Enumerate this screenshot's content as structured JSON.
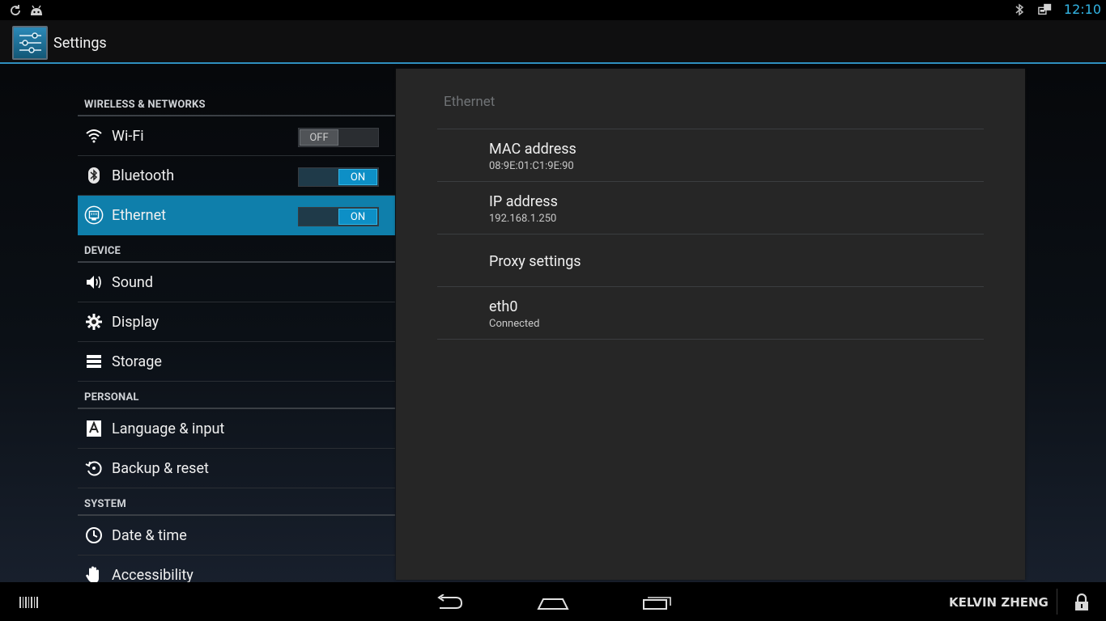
{
  "statusbar": {
    "time": "12:10",
    "left_icons": [
      "sync-icon",
      "android-debug-icon"
    ],
    "right_icons": [
      "bluetooth-icon",
      "ethernet-status-icon"
    ]
  },
  "actionbar": {
    "title": "Settings",
    "icon": "settings-app-icon"
  },
  "sidebar": {
    "sections": [
      {
        "header": "WIRELESS & NETWORKS",
        "items": [
          {
            "label": "Wi-Fi",
            "icon": "wifi-icon",
            "toggle": "OFF"
          },
          {
            "label": "Bluetooth",
            "icon": "bluetooth-icon",
            "toggle": "ON"
          },
          {
            "label": "Ethernet",
            "icon": "ethernet-icon",
            "toggle": "ON",
            "selected": true
          }
        ]
      },
      {
        "header": "DEVICE",
        "items": [
          {
            "label": "Sound",
            "icon": "speaker-icon"
          },
          {
            "label": "Display",
            "icon": "display-icon"
          },
          {
            "label": "Storage",
            "icon": "storage-icon"
          }
        ]
      },
      {
        "header": "PERSONAL",
        "items": [
          {
            "label": "Language & input",
            "icon": "language-icon"
          },
          {
            "label": "Backup & reset",
            "icon": "backup-icon"
          }
        ]
      },
      {
        "header": "SYSTEM",
        "items": [
          {
            "label": "Date & time",
            "icon": "clock-icon"
          },
          {
            "label": "Accessibility",
            "icon": "hand-icon"
          }
        ]
      }
    ]
  },
  "detail": {
    "title": "Ethernet",
    "items": [
      {
        "title": "MAC address",
        "summary": "08:9E:01:C1:9E:90"
      },
      {
        "title": "IP address",
        "summary": "192.168.1.250"
      },
      {
        "title": "Proxy settings",
        "summary": ""
      },
      {
        "title": "eth0",
        "summary": "Connected"
      }
    ]
  },
  "navbar": {
    "left_icon": "barcode-icon",
    "buttons": [
      "back-icon",
      "home-icon",
      "recent-apps-icon"
    ],
    "user": "KELVIN ZHENG",
    "lock_icon": "lock-icon"
  },
  "colors": {
    "accent": "#33b5e5",
    "selected": "#0f7fab"
  }
}
